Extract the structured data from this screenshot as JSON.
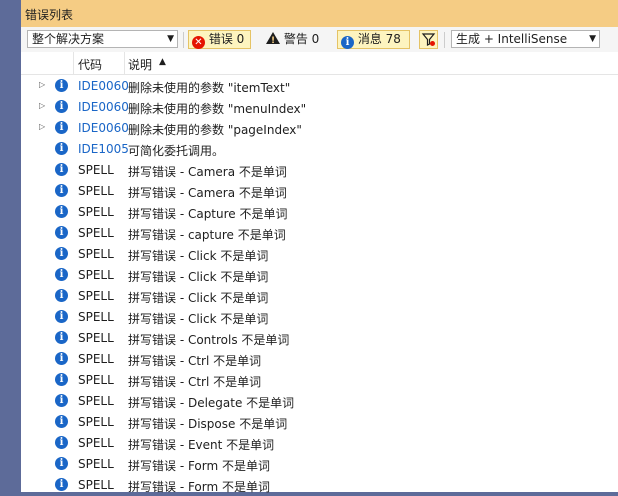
{
  "window": {
    "title": "错误列表"
  },
  "toolbar": {
    "scope_value": "整个解决方案",
    "errors_label": "错误 0",
    "warnings_label": "警告 0",
    "messages_label": "消息 78",
    "build_value": "生成 + IntelliSense"
  },
  "columns": {
    "code": "代码",
    "description": "说明",
    "sort_indicator": "▲"
  },
  "rows": [
    {
      "code": "IDE0060",
      "desc": "删除未使用的参数 \"itemText\"",
      "expandable": true
    },
    {
      "code": "IDE0060",
      "desc": "删除未使用的参数 \"menuIndex\"",
      "expandable": true
    },
    {
      "code": "IDE0060",
      "desc": "删除未使用的参数 \"pageIndex\"",
      "expandable": true
    },
    {
      "code": "IDE1005",
      "desc": "可简化委托调用。",
      "expandable": false
    },
    {
      "code": "SPELL",
      "desc": "拼写错误 - Camera 不是单词",
      "expandable": false
    },
    {
      "code": "SPELL",
      "desc": "拼写错误 - Camera 不是单词",
      "expandable": false
    },
    {
      "code": "SPELL",
      "desc": "拼写错误 - Capture 不是单词",
      "expandable": false
    },
    {
      "code": "SPELL",
      "desc": "拼写错误 - capture 不是单词",
      "expandable": false
    },
    {
      "code": "SPELL",
      "desc": "拼写错误 - Click 不是单词",
      "expandable": false
    },
    {
      "code": "SPELL",
      "desc": "拼写错误 - Click 不是单词",
      "expandable": false
    },
    {
      "code": "SPELL",
      "desc": "拼写错误 - Click 不是单词",
      "expandable": false
    },
    {
      "code": "SPELL",
      "desc": "拼写错误 - Click 不是单词",
      "expandable": false
    },
    {
      "code": "SPELL",
      "desc": "拼写错误 - Controls 不是单词",
      "expandable": false
    },
    {
      "code": "SPELL",
      "desc": "拼写错误 - Ctrl 不是单词",
      "expandable": false
    },
    {
      "code": "SPELL",
      "desc": "拼写错误 - Ctrl 不是单词",
      "expandable": false
    },
    {
      "code": "SPELL",
      "desc": "拼写错误 - Delegate 不是单词",
      "expandable": false
    },
    {
      "code": "SPELL",
      "desc": "拼写错误 - Dispose 不是单词",
      "expandable": false
    },
    {
      "code": "SPELL",
      "desc": "拼写错误 - Event 不是单词",
      "expandable": false
    },
    {
      "code": "SPELL",
      "desc": "拼写错误 - Form 不是单词",
      "expandable": false
    },
    {
      "code": "SPELL",
      "desc": "拼写错误 - Form 不是单词",
      "expandable": false
    }
  ],
  "colors": {
    "title_bar": "#f5cc84",
    "link": "#1a66c7",
    "info_icon": "#1a66c7",
    "error_icon": "#e51400"
  }
}
